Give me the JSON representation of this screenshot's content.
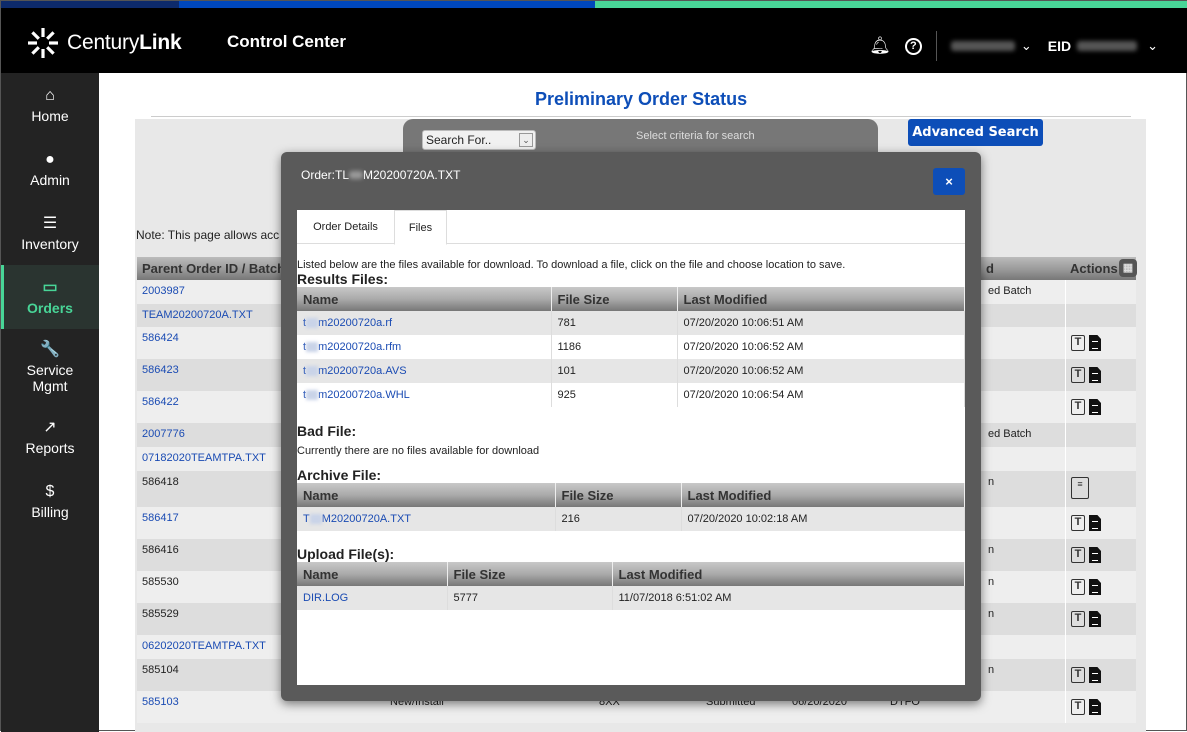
{
  "header": {
    "brand_light": "Century",
    "brand_bold": "Link",
    "app_title": "Control Center",
    "eid_label": "EID",
    "icons": {
      "bell": "bell-icon",
      "help": "help-icon"
    }
  },
  "sidebar": {
    "items": [
      {
        "label": "Home",
        "icon": "home-icon",
        "glyph": "⌂"
      },
      {
        "label": "Admin",
        "icon": "user-icon",
        "glyph": "●"
      },
      {
        "label": "Inventory",
        "icon": "list-icon",
        "glyph": "☰"
      },
      {
        "label": "Orders",
        "icon": "inbox-icon",
        "glyph": "▭",
        "active": true
      },
      {
        "label": "Service",
        "label2": "Mgmt",
        "icon": "wrench-icon",
        "glyph": "🔧"
      },
      {
        "label": "Reports",
        "icon": "chart-icon",
        "glyph": "↗"
      },
      {
        "label": "Billing",
        "icon": "invoice-icon",
        "glyph": "$"
      }
    ]
  },
  "page": {
    "title": "Preliminary Order Status",
    "search_select": "Search For..",
    "search_hint": "Select criteria for search",
    "advanced_search": "Advanced Search",
    "note": "Note: This page allows acc",
    "table_headers": {
      "col1": "Parent Order ID / Batch F",
      "col_r": "d",
      "actions": "Actions"
    },
    "rows": [
      {
        "id": "2003987",
        "link": true,
        "r": "ed Batch",
        "actions": 0
      },
      {
        "id": "TEAM20200720A.TXT",
        "link": true,
        "r": "",
        "actions": 0
      },
      {
        "id": "586424",
        "link": true,
        "r": "",
        "actions": 2
      },
      {
        "id": "586423",
        "link": true,
        "r": "",
        "actions": 2
      },
      {
        "id": "586422",
        "link": true,
        "r": "",
        "actions": 2
      },
      {
        "id": "2007776",
        "link": true,
        "r": "ed Batch",
        "actions": 0
      },
      {
        "id": "07182020TEAMTPA.TXT",
        "link": true,
        "r": "",
        "actions": 0
      },
      {
        "id": "586418",
        "link": false,
        "r": "n",
        "actions": 1
      },
      {
        "id": "586417",
        "link": true,
        "r": "",
        "actions": 2
      },
      {
        "id": "586416",
        "link": false,
        "r": "n",
        "actions": 2
      },
      {
        "id": "585530",
        "link": false,
        "r": "n",
        "actions": 2
      },
      {
        "id": "585529",
        "link": false,
        "r": "n",
        "actions": 2
      },
      {
        "id": "06202020TEAMTPA.TXT",
        "link": true,
        "r": "",
        "actions": 0
      },
      {
        "id": "585104",
        "link": false,
        "r": "n",
        "actions": 2
      },
      {
        "id": "585103",
        "link": true,
        "r": "",
        "actions": 2,
        "type": "New/Install",
        "code": "8XX",
        "status": "Submitted",
        "date": "06/20/2020",
        "dest": "DTFO"
      }
    ]
  },
  "modal": {
    "title_prefix": "Order:TL",
    "title_suffix": "M20200720A.TXT",
    "close_label": "×",
    "tabs": [
      "Order Details",
      "Files"
    ],
    "active_tab": "Files",
    "intro": "Listed below are the files available for download. To download a file, click on the file and choose location to save.",
    "columns": [
      "Name",
      "File Size",
      "Last Modified"
    ],
    "results_title": "Results Files:",
    "results_files": [
      {
        "prefix": "t",
        "name": "m20200720a.rf",
        "size": "781",
        "modified": "07/20/2020 10:06:51 AM"
      },
      {
        "prefix": "t",
        "name": "m20200720a.rfm",
        "size": "1186",
        "modified": "07/20/2020 10:06:52 AM"
      },
      {
        "prefix": "t",
        "name": "m20200720a.AVS",
        "size": "101",
        "modified": "07/20/2020 10:06:52 AM"
      },
      {
        "prefix": "t",
        "name": "m20200720a.WHL",
        "size": "925",
        "modified": "07/20/2020 10:06:54 AM"
      }
    ],
    "bad_title": "Bad File:",
    "bad_message": "Currently there are no files available for download",
    "archive_title": "Archive File:",
    "archive_files": [
      {
        "prefix": "T",
        "name": "M20200720A.TXT",
        "size": "216",
        "modified": "07/20/2020 10:02:18 AM"
      }
    ],
    "upload_title": "Upload File(s):",
    "upload_files": [
      {
        "prefix": "",
        "name": "DIR.LOG",
        "size": "5777",
        "modified": "11/07/2018 6:51:02 AM"
      }
    ]
  }
}
